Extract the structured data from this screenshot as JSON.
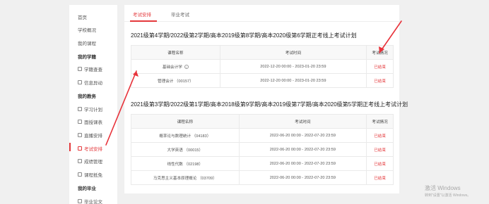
{
  "sidebar": {
    "items": [
      {
        "label": "首页",
        "type": "link"
      },
      {
        "label": "学校概况",
        "type": "link"
      },
      {
        "label": "我的课程",
        "type": "link"
      },
      {
        "label": "我的学籍",
        "type": "group"
      },
      {
        "label": "学籍查查",
        "type": "sub"
      },
      {
        "label": "信息异动",
        "type": "sub"
      },
      {
        "label": "我的教务",
        "type": "group"
      },
      {
        "label": "学习计划",
        "type": "sub"
      },
      {
        "label": "面授课表",
        "type": "sub"
      },
      {
        "label": "直播安排",
        "type": "sub"
      },
      {
        "label": "考试安排",
        "type": "sub",
        "active": true
      },
      {
        "label": "成绩管理",
        "type": "sub"
      },
      {
        "label": "课程抵免",
        "type": "sub"
      },
      {
        "label": "我的毕业",
        "type": "group"
      },
      {
        "label": "毕业论文",
        "type": "sub"
      }
    ]
  },
  "tabs": [
    {
      "label": "考试安排",
      "active": true
    },
    {
      "label": "毕业考试",
      "active": false
    }
  ],
  "sections": [
    {
      "title": "2021级第4学期/2022级第2学期/高本2019级第8学期/高本2020级第6学期正考线上考试计划",
      "headers": [
        "课程名称",
        "考试时间",
        "考试情况"
      ],
      "rows": [
        {
          "course": "基础会计学",
          "has_info": true,
          "time": "2022-12-20 00:00 - 2023-01-20 23:59",
          "status": "已结束"
        },
        {
          "course": "管理会计 （00157）",
          "has_info": false,
          "time": "2022-12-20 00:00 - 2023-01-20 23:59",
          "status": "已结束"
        }
      ]
    },
    {
      "title": "2021级第3学期/2022级第1学期/高本2018级第9学期/高本2019级第7学期/高本2020级第5学期正考线上考试计划",
      "headers": [
        "课程名称",
        "考试时间",
        "考试情况"
      ],
      "rows": [
        {
          "course": "概率论与数理统计 （04183）",
          "has_info": false,
          "time": "2022-06-20 00:00 - 2022-07-20 23:59",
          "status": "已结束"
        },
        {
          "course": "大学英语 （00015）",
          "has_info": false,
          "time": "2022-06-20 00:00 - 2022-07-20 23:59",
          "status": "已结束"
        },
        {
          "course": "线性代数 （02198）",
          "has_info": false,
          "time": "2022-06-20 00:00 - 2022-07-20 23:59",
          "status": "已结束"
        },
        {
          "course": "马克思主义基本原理概论 （03709）",
          "has_info": false,
          "time": "2022-06-20 00:00 - 2022-07-20 23:59",
          "status": "已结束"
        }
      ]
    }
  ],
  "info_icon_glyph": "i",
  "watermark": {
    "line1": "激活 Windows",
    "line2": "转到\"设置\"以激活 Windows。"
  },
  "colors": {
    "accent": "#e4393c",
    "annotation_arrow": "#e8323a"
  }
}
